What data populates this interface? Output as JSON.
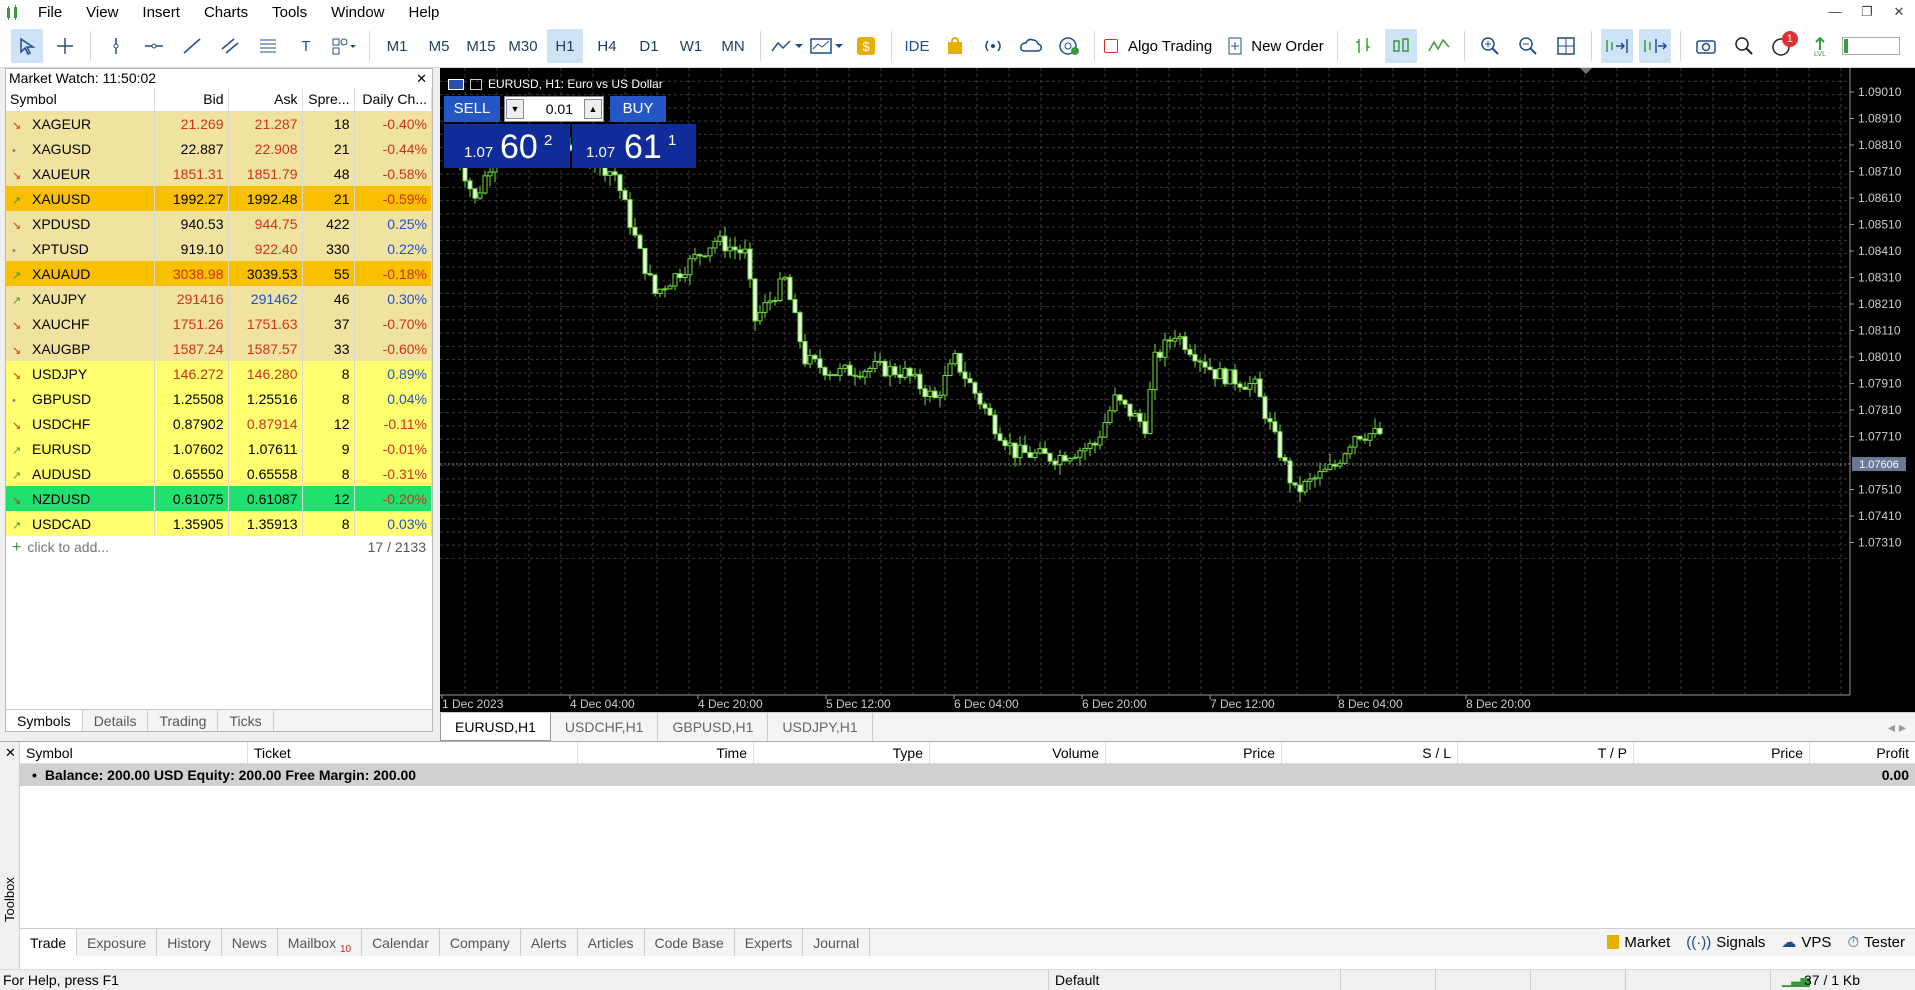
{
  "menu": [
    "File",
    "View",
    "Insert",
    "Charts",
    "Tools",
    "Window",
    "Help"
  ],
  "toolbar": {
    "timeframes": [
      "M1",
      "M5",
      "M15",
      "M30",
      "H1",
      "H4",
      "D1",
      "W1",
      "MN"
    ],
    "active_timeframe": "H1",
    "ide_label": "IDE",
    "algo_label": "Algo Trading",
    "new_order_label": "New Order",
    "notification_count": "1"
  },
  "market_watch": {
    "title": "Market Watch: 11:50:02",
    "columns": [
      "Symbol",
      "Bid",
      "Ask",
      "Spre...",
      "Daily Ch..."
    ],
    "rows": [
      {
        "symbol": "XAGEUR",
        "bid": "21.269",
        "ask": "21.287",
        "spread": "18",
        "change": "-0.40%",
        "dir": "down",
        "bg": "#f0e3a0",
        "bidc": "#d03020",
        "askc": "#d03020"
      },
      {
        "symbol": "XAGUSD",
        "bid": "22.887",
        "ask": "22.908",
        "spread": "21",
        "change": "-0.44%",
        "dir": "flat",
        "bg": "#f0e3a0",
        "bidc": "#000",
        "askc": "#d03020"
      },
      {
        "symbol": "XAUEUR",
        "bid": "1851.31",
        "ask": "1851.79",
        "spread": "48",
        "change": "-0.58%",
        "dir": "down",
        "bg": "#f0e3a0",
        "bidc": "#d03020",
        "askc": "#d03020"
      },
      {
        "symbol": "XAUUSD",
        "bid": "1992.27",
        "ask": "1992.48",
        "spread": "21",
        "change": "-0.59%",
        "dir": "up",
        "bg": "#f8c000",
        "bidc": "#000",
        "askc": "#000"
      },
      {
        "symbol": "XPDUSD",
        "bid": "940.53",
        "ask": "944.75",
        "spread": "422",
        "change": "0.25%",
        "dir": "down",
        "bg": "#f0e3a0",
        "bidc": "#000",
        "askc": "#d03020"
      },
      {
        "symbol": "XPTUSD",
        "bid": "919.10",
        "ask": "922.40",
        "spread": "330",
        "change": "0.22%",
        "dir": "flat",
        "bg": "#f0e3a0",
        "bidc": "#000",
        "askc": "#d03020"
      },
      {
        "symbol": "XAUAUD",
        "bid": "3038.98",
        "ask": "3039.53",
        "spread": "55",
        "change": "-0.18%",
        "dir": "up",
        "bg": "#f8c000",
        "bidc": "#d03020",
        "askc": "#000"
      },
      {
        "symbol": "XAUJPY",
        "bid": "291416",
        "ask": "291462",
        "spread": "46",
        "change": "0.30%",
        "dir": "up",
        "bg": "#f0e3a0",
        "bidc": "#d03020",
        "askc": "#2050d0"
      },
      {
        "symbol": "XAUCHF",
        "bid": "1751.26",
        "ask": "1751.63",
        "spread": "37",
        "change": "-0.70%",
        "dir": "down",
        "bg": "#f0e3a0",
        "bidc": "#d03020",
        "askc": "#d03020"
      },
      {
        "symbol": "XAUGBP",
        "bid": "1587.24",
        "ask": "1587.57",
        "spread": "33",
        "change": "-0.60%",
        "dir": "down",
        "bg": "#f0e3a0",
        "bidc": "#d03020",
        "askc": "#d03020"
      },
      {
        "symbol": "USDJPY",
        "bid": "146.272",
        "ask": "146.280",
        "spread": "8",
        "change": "0.89%",
        "dir": "down",
        "bg": "#ffff70",
        "bidc": "#d03020",
        "askc": "#d03020"
      },
      {
        "symbol": "GBPUSD",
        "bid": "1.25508",
        "ask": "1.25516",
        "spread": "8",
        "change": "0.04%",
        "dir": "flat",
        "bg": "#ffff70",
        "bidc": "#000",
        "askc": "#000"
      },
      {
        "symbol": "USDCHF",
        "bid": "0.87902",
        "ask": "0.87914",
        "spread": "12",
        "change": "-0.11%",
        "dir": "down",
        "bg": "#ffff70",
        "bidc": "#000",
        "askc": "#d03020"
      },
      {
        "symbol": "EURUSD",
        "bid": "1.07602",
        "ask": "1.07611",
        "spread": "9",
        "change": "-0.01%",
        "dir": "up",
        "bg": "#ffff70",
        "bidc": "#000",
        "askc": "#000"
      },
      {
        "symbol": "AUDUSD",
        "bid": "0.65550",
        "ask": "0.65558",
        "spread": "8",
        "change": "-0.31%",
        "dir": "up",
        "bg": "#ffff70",
        "bidc": "#000",
        "askc": "#000"
      },
      {
        "symbol": "NZDUSD",
        "bid": "0.61075",
        "ask": "0.61087",
        "spread": "12",
        "change": "-0.20%",
        "dir": "down",
        "bg": "#20e070",
        "bidc": "#000",
        "askc": "#000"
      },
      {
        "symbol": "USDCAD",
        "bid": "1.35905",
        "ask": "1.35913",
        "spread": "8",
        "change": "0.03%",
        "dir": "up",
        "bg": "#ffff70",
        "bidc": "#000",
        "askc": "#000"
      }
    ],
    "add_label": "click to add...",
    "count": "17 / 2133",
    "tabs": [
      "Symbols",
      "Details",
      "Trading",
      "Ticks"
    ]
  },
  "chart": {
    "title": "EURUSD, H1:  Euro vs US Dollar",
    "sell_label": "SELL",
    "buy_label": "BUY",
    "lot": "0.01",
    "sell_price": {
      "prefix": "1.07",
      "big": "60",
      "sup": "2"
    },
    "buy_price": {
      "prefix": "1.07",
      "big": "61",
      "sup": "1"
    },
    "price_labels": [
      "1.09010",
      "1.08910",
      "1.08810",
      "1.08710",
      "1.08610",
      "1.08510",
      "1.08410",
      "1.08310",
      "1.08210",
      "1.08110",
      "1.08010",
      "1.07910",
      "1.07810",
      "1.07710",
      "1.07510",
      "1.07410",
      "1.07310"
    ],
    "current_price": "1.07606",
    "time_labels": [
      "1 Dec 2023",
      "4 Dec 04:00",
      "4 Dec 20:00",
      "5 Dec 12:00",
      "6 Dec 04:00",
      "6 Dec 20:00",
      "7 Dec 12:00",
      "8 Dec 04:00",
      "8 Dec 20:00"
    ],
    "tabs": [
      "EURUSD,H1",
      "USDCHF,H1",
      "GBPUSD,H1",
      "USDJPY,H1"
    ]
  },
  "toolbox": {
    "label": "Toolbox",
    "columns": [
      "Symbol",
      "Ticket",
      "Time",
      "Type",
      "Volume",
      "Price",
      "S / L",
      "T / P",
      "Price",
      "Profit"
    ],
    "balance": "Balance: 200.00 USD  Equity: 200.00  Free Margin: 200.00",
    "profit": "0.00",
    "tabs": [
      "Trade",
      "Exposure",
      "History",
      "News",
      "Mailbox",
      "Calendar",
      "Company",
      "Alerts",
      "Articles",
      "Code Base",
      "Experts",
      "Journal"
    ],
    "mailbox_badge": "10",
    "right": [
      "Market",
      "Signals",
      "VPS",
      "Tester"
    ]
  },
  "status": {
    "help": "For Help, press F1",
    "profile": "Default",
    "traffic": "37 / 1 Kb"
  }
}
